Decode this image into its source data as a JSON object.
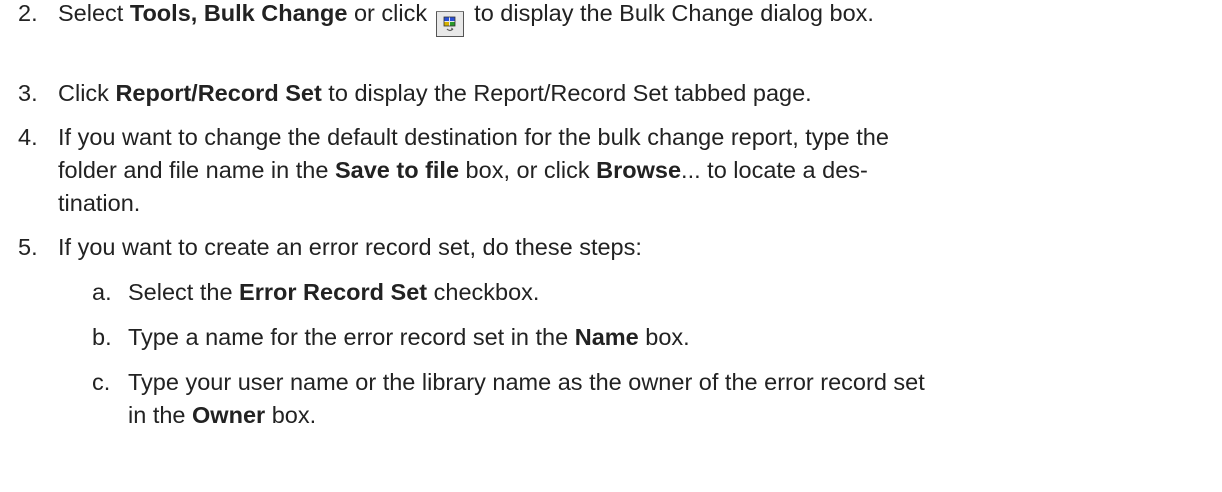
{
  "steps": [
    {
      "number": "2.",
      "parts": {
        "a": "Select ",
        "b": "Tools, Bulk Change",
        "c": " or click ",
        "d": " to display the Bulk Change dialog box."
      }
    },
    {
      "number": "3.",
      "parts": {
        "a": "Click ",
        "b": "Report/Record Set",
        "c": " to display the Report/Record Set tabbed page."
      }
    },
    {
      "number": "4.",
      "lines": {
        "l1": "If you want to change the default destination for the bulk change report, type the",
        "l2a": "folder and file name in the ",
        "l2b": "Save to file",
        "l2c": " box, or click ",
        "l2d": "Browse",
        "l2e": "... to locate a des-",
        "l3": "tination."
      }
    },
    {
      "number": "5.",
      "text": "If you want to create an error record set, do these steps:"
    }
  ],
  "substeps": [
    {
      "letter": "a.",
      "parts": {
        "a": "Select the ",
        "b": "Error Record Set",
        "c": " checkbox."
      }
    },
    {
      "letter": "b.",
      "parts": {
        "a": "Type a name for the error record set in the ",
        "b": "Name",
        "c": " box."
      }
    },
    {
      "letter": "c.",
      "lines": {
        "l1": "Type your user name or the library name as the owner of the error record set",
        "l2a": "in the ",
        "l2b": "Owner",
        "l2c": " box."
      }
    }
  ],
  "icons": {
    "bulk_change": "bulk-change-toolbar-icon"
  }
}
